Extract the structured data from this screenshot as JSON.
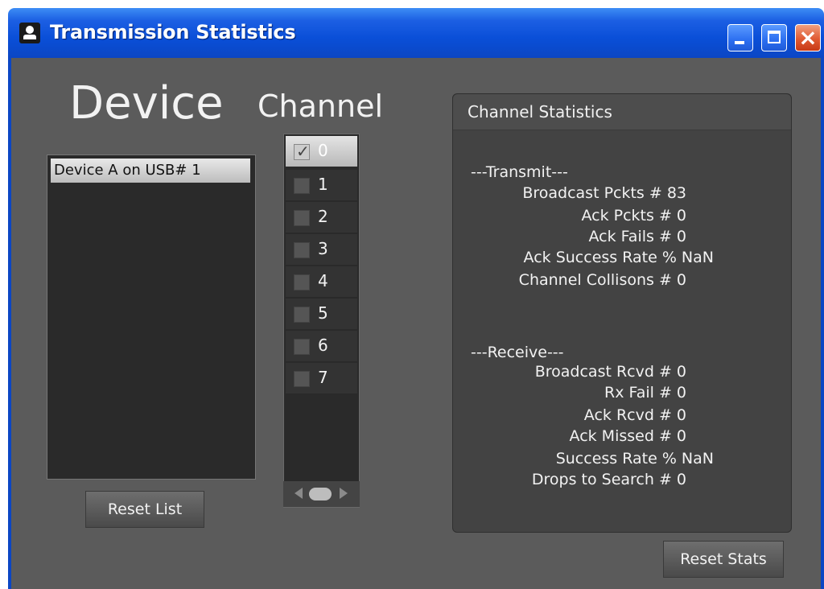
{
  "window": {
    "title": "Transmission Statistics",
    "icon": "app-icon",
    "controls": {
      "minimize": "minimize-icon",
      "maximize": "maximize-icon",
      "close": "close-icon"
    }
  },
  "device_panel": {
    "heading": "Device",
    "items": [
      "Device A on USB# 1"
    ],
    "reset_label": "Reset List"
  },
  "channel_panel": {
    "heading": "Channel",
    "items": [
      {
        "label": "0",
        "checked": true
      },
      {
        "label": "1",
        "checked": false
      },
      {
        "label": "2",
        "checked": false
      },
      {
        "label": "3",
        "checked": false
      },
      {
        "label": "4",
        "checked": false
      },
      {
        "label": "5",
        "checked": false
      },
      {
        "label": "6",
        "checked": false
      },
      {
        "label": "7",
        "checked": false
      }
    ]
  },
  "stats": {
    "title": "Channel Statistics",
    "transmit_header": "---Transmit---",
    "transmit": [
      "Broadcast Pckts # 83",
      "Ack Pckts # 0",
      "Ack Fails # 0",
      "Ack Success Rate % NaN",
      "Channel Collisons # 0"
    ],
    "receive_header": "---Receive---",
    "receive": [
      "Broadcast Rcvd # 0",
      "Rx Fail # 0",
      "Ack Rcvd # 0",
      "Ack Missed # 0",
      "Success Rate % NaN",
      "Drops to Search # 0"
    ],
    "reset_label": "Reset Stats"
  },
  "colors": {
    "titlebar": "#0b46c4",
    "client_bg": "#5b5b5b",
    "panel_bg": "#434343",
    "list_bg": "#2a2a2a"
  }
}
